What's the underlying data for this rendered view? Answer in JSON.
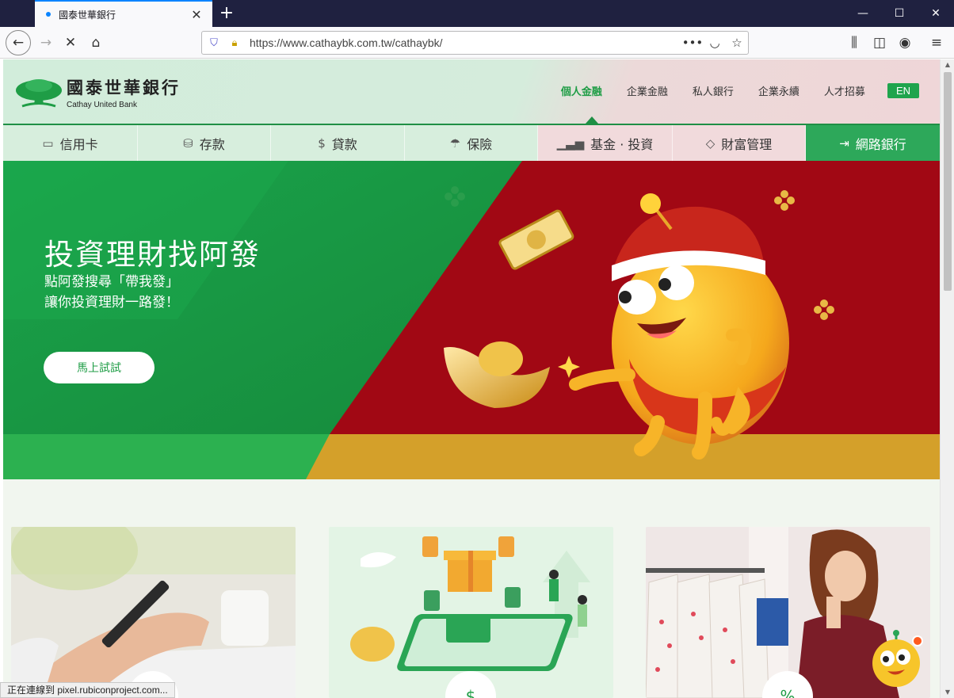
{
  "browser": {
    "tab_title": "國泰世華銀行",
    "url": "https://www.cathaybk.com.tw/cathaybk/",
    "status_text": "正在連線到 pixel.rubiconproject.com..."
  },
  "site": {
    "logo_zh": "國泰世華銀行",
    "logo_en": "Cathay United Bank",
    "top_nav": [
      "個人金融",
      "企業金融",
      "私人銀行",
      "企業永續",
      "人才招募"
    ],
    "lang_button": "EN",
    "main_nav": [
      {
        "label": "信用卡",
        "icon": "credit-card-icon"
      },
      {
        "label": "存款",
        "icon": "coins-icon"
      },
      {
        "label": "貸款",
        "icon": "money-bag-icon"
      },
      {
        "label": "保險",
        "icon": "umbrella-icon"
      },
      {
        "label": "基金 · 投資",
        "icon": "chart-icon"
      },
      {
        "label": "財富管理",
        "icon": "diamond-icon"
      },
      {
        "label": "網路銀行",
        "icon": "login-icon"
      }
    ]
  },
  "banner": {
    "title": "投資理財找阿發",
    "line1": "點阿發搜尋「帶我發」",
    "line2": "讓你投資理財一路發！",
    "cta": "馬上試試"
  },
  "cards": [
    {
      "image": "hand-holding-phone-photo",
      "icon": "card-icon"
    },
    {
      "image": "mobile-banking-illustration",
      "icon": "card-money-icon"
    },
    {
      "image": "woman-shopping-photo",
      "icon": "percent-tag-icon"
    }
  ],
  "colors": {
    "brand_green": "#1f9d46",
    "banner_red": "#a10814",
    "banner_gold": "#d4a02a"
  }
}
